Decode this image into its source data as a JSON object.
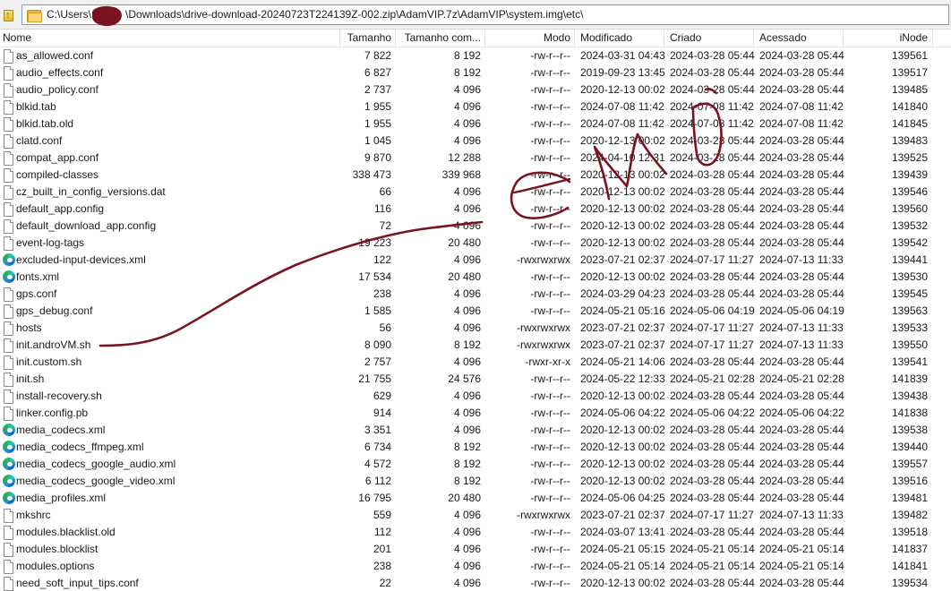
{
  "address_bar": {
    "path_prefix": "C:\\Users\\",
    "path_suffix": "\\Downloads\\drive-download-20240723T224139Z-002.zip\\AdamVIP.7z\\AdamVIP\\system.img\\etc\\"
  },
  "columns": {
    "name": "Nome",
    "size": "Tamanho",
    "compressed_size": "Tamanho com...",
    "mode": "Modo",
    "modified": "Modificado",
    "created": "Criado",
    "accessed": "Acessado",
    "inode": "iNode"
  },
  "files": [
    {
      "name": "as_allowed.conf",
      "icon": "file-icon",
      "size": "7 822",
      "csize": "8 192",
      "mode": "-rw-r--r--",
      "modified": "2024-03-31 04:43",
      "created": "2024-03-28 05:44",
      "accessed": "2024-03-28 05:44",
      "inode": "139561"
    },
    {
      "name": "audio_effects.conf",
      "icon": "file-icon",
      "size": "6 827",
      "csize": "8 192",
      "mode": "-rw-r--r--",
      "modified": "2019-09-23 13:45",
      "created": "2024-03-28 05:44",
      "accessed": "2024-03-28 05:44",
      "inode": "139517"
    },
    {
      "name": "audio_policy.conf",
      "icon": "file-icon",
      "size": "2 737",
      "csize": "4 096",
      "mode": "-rw-r--r--",
      "modified": "2020-12-13 00:02",
      "created": "2024-03-28 05:44",
      "accessed": "2024-03-28 05:44",
      "inode": "139485"
    },
    {
      "name": "blkid.tab",
      "icon": "file-icon",
      "size": "1 955",
      "csize": "4 096",
      "mode": "-rw-r--r--",
      "modified": "2024-07-08 11:42",
      "created": "2024-07-08 11:42",
      "accessed": "2024-07-08 11:42",
      "inode": "141840"
    },
    {
      "name": "blkid.tab.old",
      "icon": "file-icon",
      "size": "1 955",
      "csize": "4 096",
      "mode": "-rw-r--r--",
      "modified": "2024-07-08 11:42",
      "created": "2024-07-08 11:42",
      "accessed": "2024-07-08 11:42",
      "inode": "141845"
    },
    {
      "name": "clatd.conf",
      "icon": "file-icon",
      "size": "1 045",
      "csize": "4 096",
      "mode": "-rw-r--r--",
      "modified": "2020-12-13 00:02",
      "created": "2024-03-28 05:44",
      "accessed": "2024-03-28 05:44",
      "inode": "139483"
    },
    {
      "name": "compat_app.conf",
      "icon": "file-icon",
      "size": "9 870",
      "csize": "12 288",
      "mode": "-rw-r--r--",
      "modified": "2024-04-10 12:31",
      "created": "2024-03-28 05:44",
      "accessed": "2024-03-28 05:44",
      "inode": "139525"
    },
    {
      "name": "compiled-classes",
      "icon": "file-icon",
      "size": "338 473",
      "csize": "339 968",
      "mode": "-rw-r--r--",
      "modified": "2020-12-13 00:02",
      "created": "2024-03-28 05:44",
      "accessed": "2024-03-28 05:44",
      "inode": "139439"
    },
    {
      "name": "cz_built_in_config_versions.dat",
      "icon": "file-icon",
      "size": "66",
      "csize": "4 096",
      "mode": "-rw-r--r--",
      "modified": "2020-12-13 00:02",
      "created": "2024-03-28 05:44",
      "accessed": "2024-03-28 05:44",
      "inode": "139546"
    },
    {
      "name": "default_app.config",
      "icon": "file-icon",
      "size": "116",
      "csize": "4 096",
      "mode": "-rw-r--r--",
      "modified": "2020-12-13 00:02",
      "created": "2024-03-28 05:44",
      "accessed": "2024-03-28 05:44",
      "inode": "139560"
    },
    {
      "name": "default_download_app.config",
      "icon": "file-icon",
      "size": "72",
      "csize": "4 096",
      "mode": "-rw-r--r--",
      "modified": "2020-12-13 00:02",
      "created": "2024-03-28 05:44",
      "accessed": "2024-03-28 05:44",
      "inode": "139532"
    },
    {
      "name": "event-log-tags",
      "icon": "file-icon",
      "size": "19 223",
      "csize": "20 480",
      "mode": "-rw-r--r--",
      "modified": "2020-12-13 00:02",
      "created": "2024-03-28 05:44",
      "accessed": "2024-03-28 05:44",
      "inode": "139542"
    },
    {
      "name": "excluded-input-devices.xml",
      "icon": "edge-icon",
      "size": "122",
      "csize": "4 096",
      "mode": "-rwxrwxrwx",
      "modified": "2023-07-21 02:37",
      "created": "2024-07-17 11:27",
      "accessed": "2024-07-13 11:33",
      "inode": "139441"
    },
    {
      "name": "fonts.xml",
      "icon": "edge-icon",
      "size": "17 534",
      "csize": "20 480",
      "mode": "-rw-r--r--",
      "modified": "2020-12-13 00:02",
      "created": "2024-03-28 05:44",
      "accessed": "2024-03-28 05:44",
      "inode": "139530"
    },
    {
      "name": "gps.conf",
      "icon": "file-icon",
      "size": "238",
      "csize": "4 096",
      "mode": "-rw-r--r--",
      "modified": "2024-03-29 04:23",
      "created": "2024-03-28 05:44",
      "accessed": "2024-03-28 05:44",
      "inode": "139545"
    },
    {
      "name": "gps_debug.conf",
      "icon": "file-icon",
      "size": "1 585",
      "csize": "4 096",
      "mode": "-rw-r--r--",
      "modified": "2024-05-21 05:16",
      "created": "2024-05-06 04:19",
      "accessed": "2024-05-06 04:19",
      "inode": "139563"
    },
    {
      "name": "hosts",
      "icon": "file-icon",
      "size": "56",
      "csize": "4 096",
      "mode": "-rwxrwxrwx",
      "modified": "2023-07-21 02:37",
      "created": "2024-07-17 11:27",
      "accessed": "2024-07-13 11:33",
      "inode": "139533"
    },
    {
      "name": "init.androVM.sh",
      "icon": "file-icon",
      "size": "8 090",
      "csize": "8 192",
      "mode": "-rwxrwxrwx",
      "modified": "2023-07-21 02:37",
      "created": "2024-07-17 11:27",
      "accessed": "2024-07-13 11:33",
      "inode": "139550"
    },
    {
      "name": "init.custom.sh",
      "icon": "file-icon",
      "size": "2 757",
      "csize": "4 096",
      "mode": "-rwxr-xr-x",
      "modified": "2024-05-21 14:06",
      "created": "2024-03-28 05:44",
      "accessed": "2024-03-28 05:44",
      "inode": "139541"
    },
    {
      "name": "init.sh",
      "icon": "file-icon",
      "size": "21 755",
      "csize": "24 576",
      "mode": "-rw-r--r--",
      "modified": "2024-05-22 12:33",
      "created": "2024-05-21 02:28",
      "accessed": "2024-05-21 02:28",
      "inode": "141839"
    },
    {
      "name": "install-recovery.sh",
      "icon": "file-icon",
      "size": "629",
      "csize": "4 096",
      "mode": "-rw-r--r--",
      "modified": "2020-12-13 00:02",
      "created": "2024-03-28 05:44",
      "accessed": "2024-03-28 05:44",
      "inode": "139438"
    },
    {
      "name": "linker.config.pb",
      "icon": "file-icon",
      "size": "914",
      "csize": "4 096",
      "mode": "-rw-r--r--",
      "modified": "2024-05-06 04:22",
      "created": "2024-05-06 04:22",
      "accessed": "2024-05-06 04:22",
      "inode": "141838"
    },
    {
      "name": "media_codecs.xml",
      "icon": "edge-icon",
      "size": "3 351",
      "csize": "4 096",
      "mode": "-rw-r--r--",
      "modified": "2020-12-13 00:02",
      "created": "2024-03-28 05:44",
      "accessed": "2024-03-28 05:44",
      "inode": "139538"
    },
    {
      "name": "media_codecs_ffmpeg.xml",
      "icon": "edge-icon",
      "size": "6 734",
      "csize": "8 192",
      "mode": "-rw-r--r--",
      "modified": "2020-12-13 00:02",
      "created": "2024-03-28 05:44",
      "accessed": "2024-03-28 05:44",
      "inode": "139440"
    },
    {
      "name": "media_codecs_google_audio.xml",
      "icon": "edge-icon",
      "size": "4 572",
      "csize": "8 192",
      "mode": "-rw-r--r--",
      "modified": "2020-12-13 00:02",
      "created": "2024-03-28 05:44",
      "accessed": "2024-03-28 05:44",
      "inode": "139557"
    },
    {
      "name": "media_codecs_google_video.xml",
      "icon": "edge-icon",
      "size": "6 112",
      "csize": "8 192",
      "mode": "-rw-r--r--",
      "modified": "2020-12-13 00:02",
      "created": "2024-03-28 05:44",
      "accessed": "2024-03-28 05:44",
      "inode": "139516"
    },
    {
      "name": "media_profiles.xml",
      "icon": "edge-icon",
      "size": "16 795",
      "csize": "20 480",
      "mode": "-rw-r--r--",
      "modified": "2024-05-06 04:25",
      "created": "2024-03-28 05:44",
      "accessed": "2024-03-28 05:44",
      "inode": "139481"
    },
    {
      "name": "mkshrc",
      "icon": "file-icon",
      "size": "559",
      "csize": "4 096",
      "mode": "-rwxrwxrwx",
      "modified": "2023-07-21 02:37",
      "created": "2024-07-17 11:27",
      "accessed": "2024-07-13 11:33",
      "inode": "139482"
    },
    {
      "name": "modules.blacklist.old",
      "icon": "file-icon",
      "size": "112",
      "csize": "4 096",
      "mode": "-rw-r--r--",
      "modified": "2024-03-07 13:41",
      "created": "2024-03-28 05:44",
      "accessed": "2024-03-28 05:44",
      "inode": "139518"
    },
    {
      "name": "modules.blocklist",
      "icon": "file-icon",
      "size": "201",
      "csize": "4 096",
      "mode": "-rw-r--r--",
      "modified": "2024-05-21 05:15",
      "created": "2024-05-21 05:14",
      "accessed": "2024-05-21 05:14",
      "inode": "141837"
    },
    {
      "name": "modules.options",
      "icon": "file-icon",
      "size": "238",
      "csize": "4 096",
      "mode": "-rw-r--r--",
      "modified": "2024-05-21 05:14",
      "created": "2024-05-21 05:14",
      "accessed": "2024-05-21 05:14",
      "inode": "141841"
    },
    {
      "name": "need_soft_input_tips.conf",
      "icon": "file-icon",
      "size": "22",
      "csize": "4 096",
      "mode": "-rw-r--r--",
      "modified": "2020-12-13 00:02",
      "created": "2024-03-28 05:44",
      "accessed": "2024-03-28 05:44",
      "inode": "139534"
    }
  ],
  "colors": {
    "ink": "#7a1220",
    "address_border": "#7a9cc9",
    "header_separator": "#e5e5e5"
  }
}
